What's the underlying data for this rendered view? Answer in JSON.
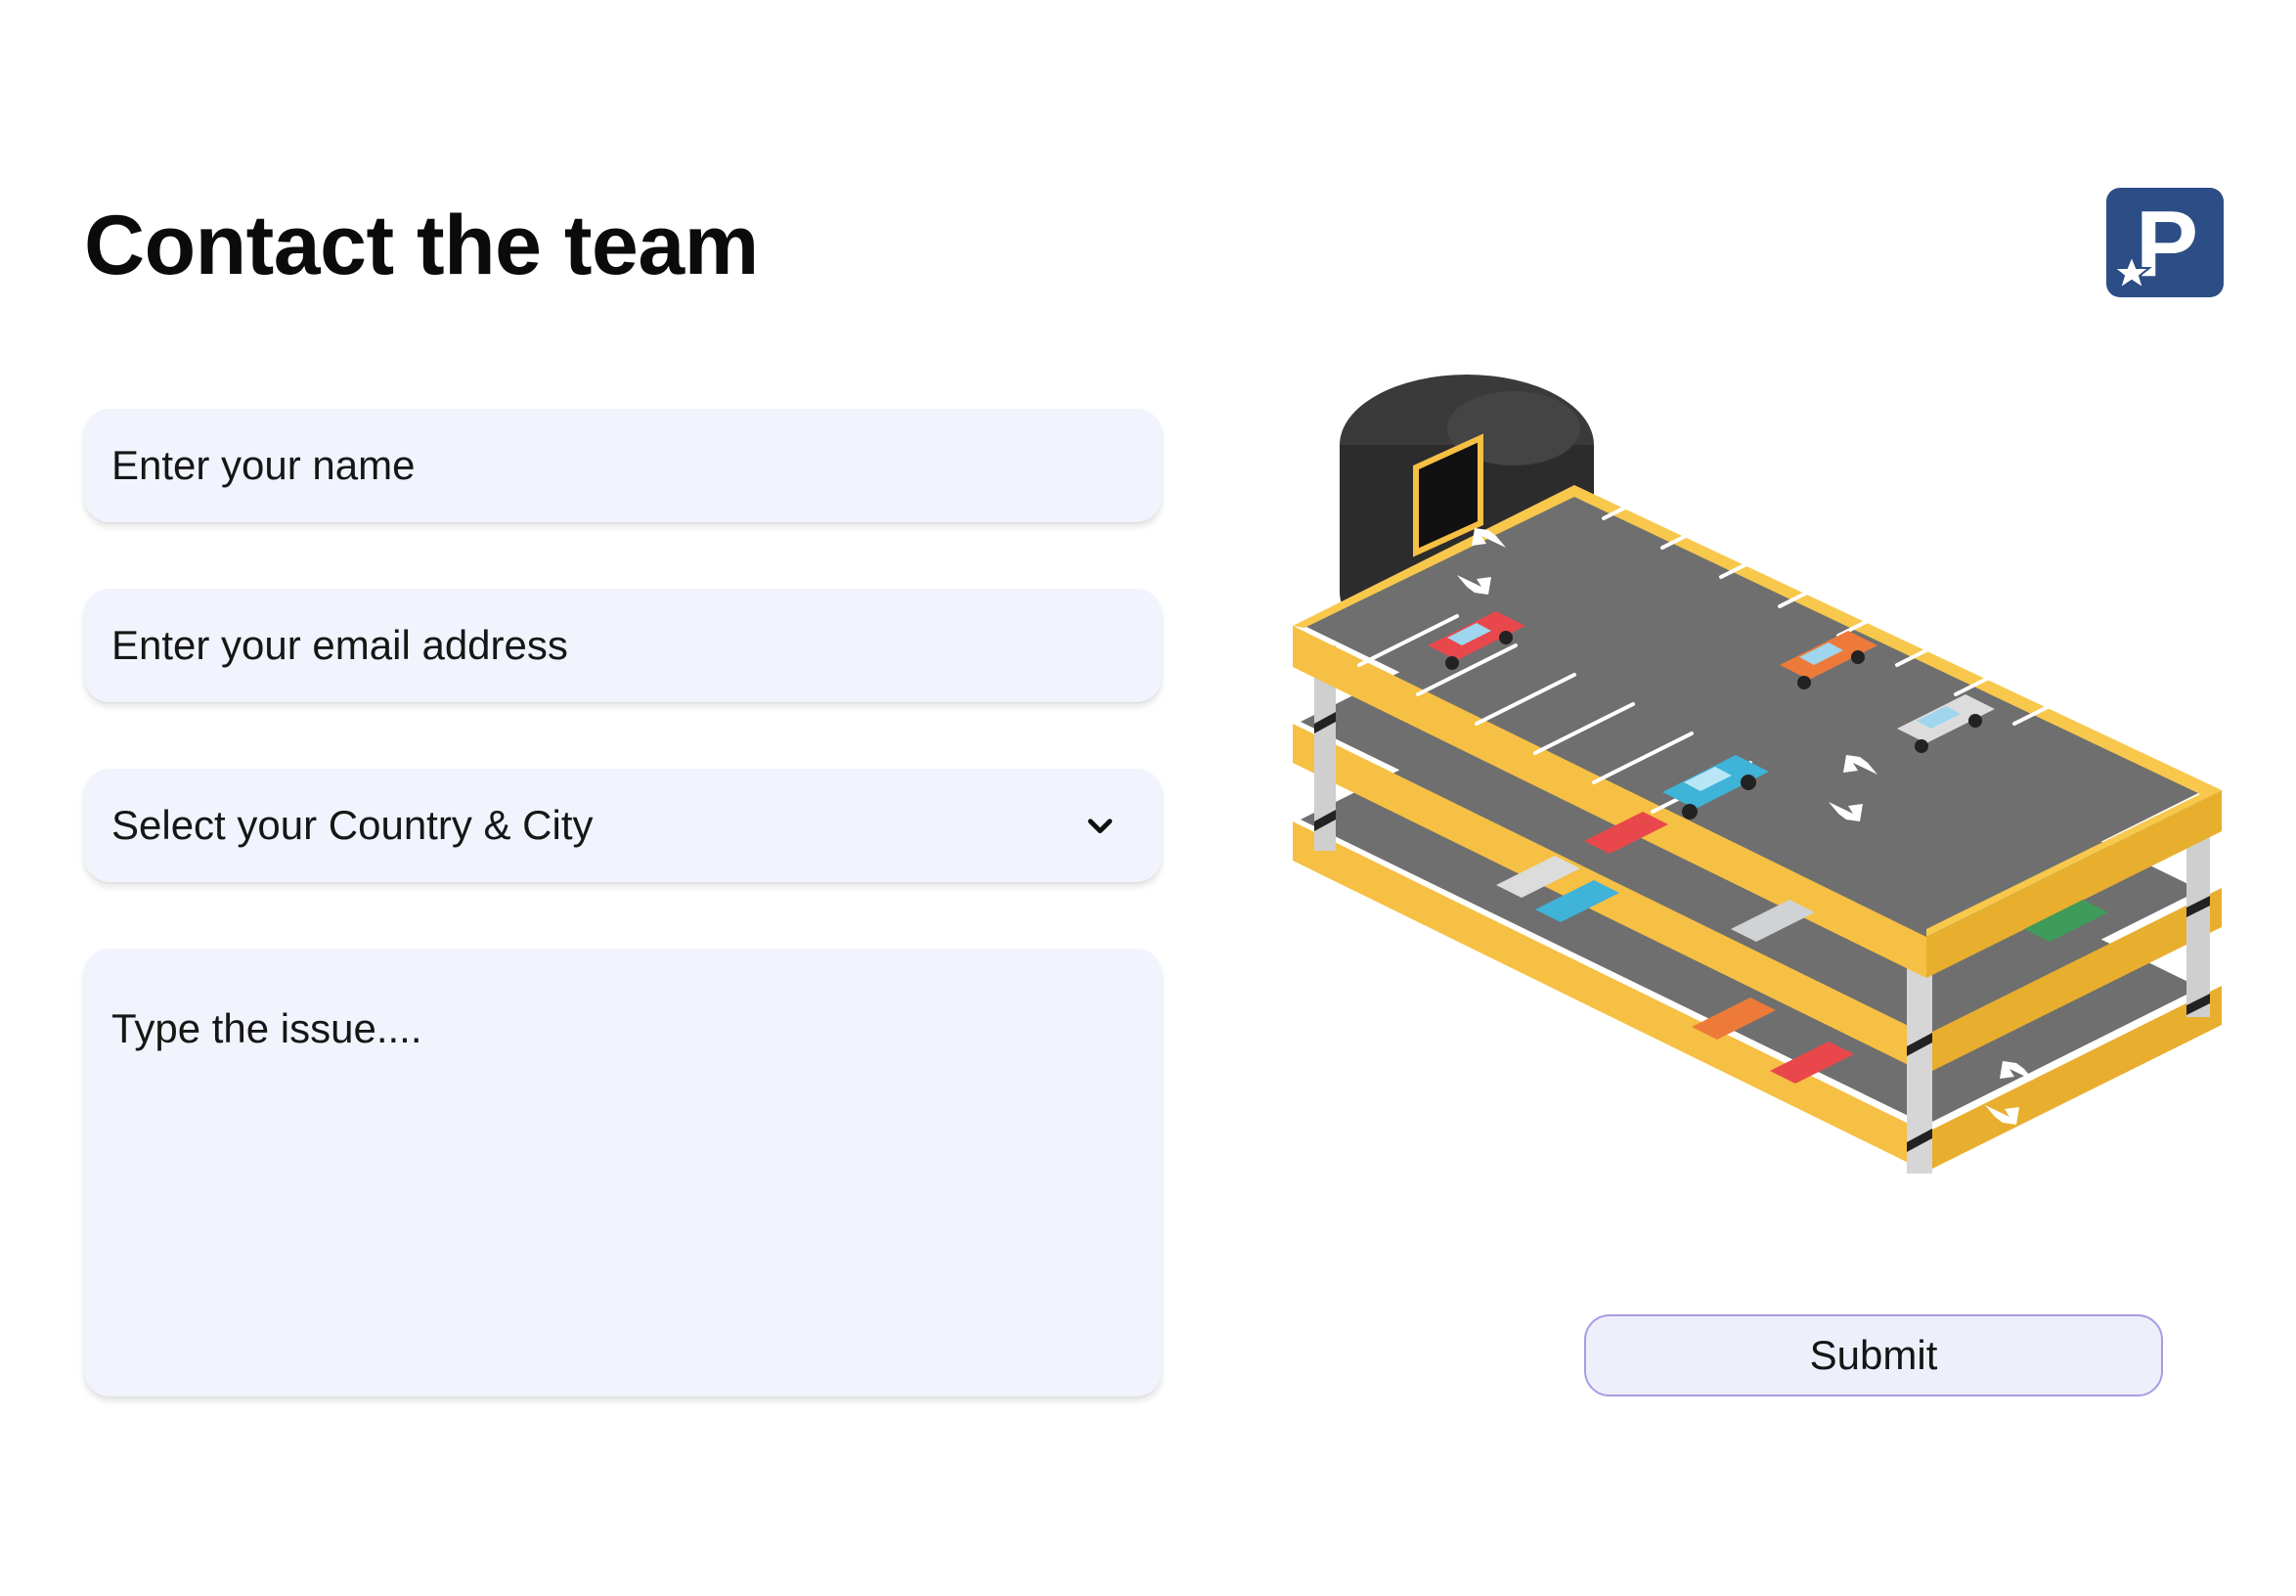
{
  "header": {
    "title": "Contact the team"
  },
  "form": {
    "name_placeholder": "Enter your name",
    "email_placeholder": "Enter your email address",
    "location_placeholder": "Select your Country & City",
    "issue_placeholder": "Type the issue...."
  },
  "actions": {
    "submit_label": "Submit"
  },
  "logo": {
    "letter": "P",
    "icon": "parking-star-logo"
  },
  "colors": {
    "field_bg": "#f1f4fd",
    "logo_bg": "#2c4d85",
    "structure_yellow": "#f5c043",
    "asphalt": "#707070",
    "submit_border": "#a99be4"
  }
}
